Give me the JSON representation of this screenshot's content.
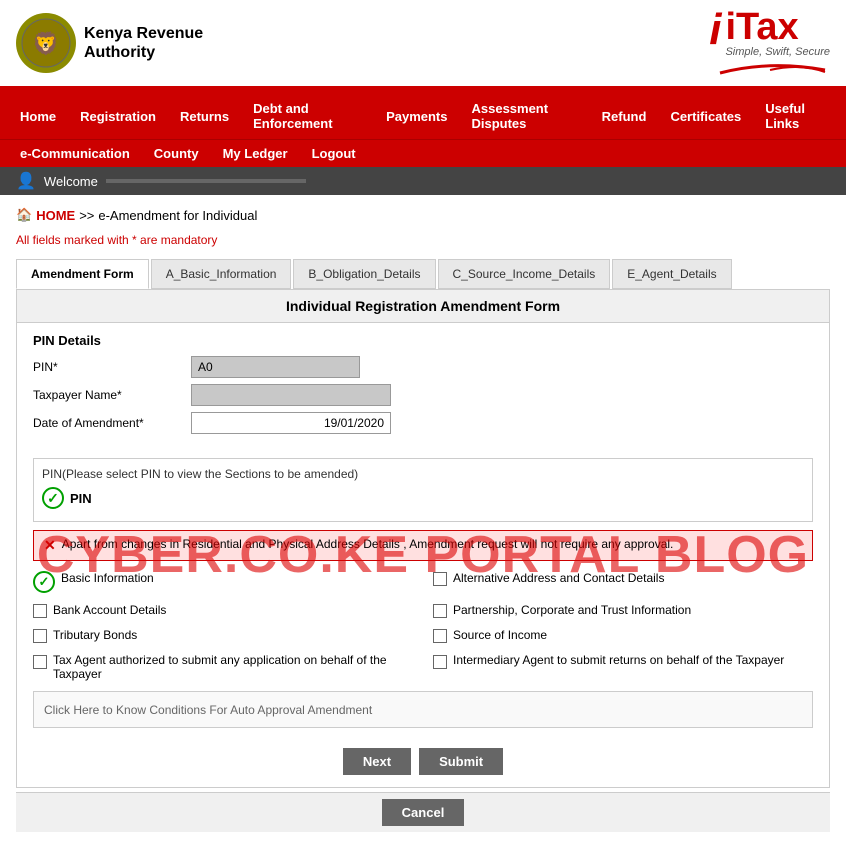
{
  "header": {
    "kra_name_line1": "Kenya Revenue",
    "kra_name_line2": "Authority",
    "itax_brand": "iTax",
    "itax_tagline": "Simple, Swift, Secure"
  },
  "nav_primary": {
    "items": [
      {
        "label": "Home",
        "id": "home"
      },
      {
        "label": "Registration",
        "id": "registration"
      },
      {
        "label": "Returns",
        "id": "returns"
      },
      {
        "label": "Debt and Enforcement",
        "id": "debt"
      },
      {
        "label": "Payments",
        "id": "payments"
      },
      {
        "label": "Assessment Disputes",
        "id": "assessment"
      },
      {
        "label": "Refund",
        "id": "refund"
      },
      {
        "label": "Certificates",
        "id": "certificates"
      },
      {
        "label": "Useful Links",
        "id": "useful"
      }
    ]
  },
  "nav_secondary": {
    "items": [
      {
        "label": "e-Communication",
        "id": "ecommunication"
      },
      {
        "label": "County",
        "id": "county"
      },
      {
        "label": "My Ledger",
        "id": "myledger"
      },
      {
        "label": "Logout",
        "id": "logout"
      }
    ]
  },
  "welcome": {
    "label": "Welcome"
  },
  "breadcrumb": {
    "home": "HOME",
    "separator": ">>",
    "current": "e-Amendment for Individual"
  },
  "mandatory_note": "All fields marked with * are mandatory",
  "tabs": [
    {
      "label": "Amendment Form",
      "active": true
    },
    {
      "label": "A_Basic_Information"
    },
    {
      "label": "B_Obligation_Details"
    },
    {
      "label": "C_Source_Income_Details"
    },
    {
      "label": "E_Agent_Details"
    }
  ],
  "form_title": "Individual Registration Amendment Form",
  "watermark": "CYBER.CO.KE PORTAL BLOG",
  "pin_details": {
    "section_title": "PIN Details",
    "pin_label": "PIN*",
    "pin_value": "A0",
    "taxpayer_label": "Taxpayer Name*",
    "taxpayer_value": "",
    "date_label": "Date of Amendment*",
    "date_value": "19/01/2020"
  },
  "pin_selection": {
    "label": "PIN(Please select PIN to view the Sections to be amended)",
    "pin_checkbox_label": "PIN",
    "pin_checked": true
  },
  "info_message": "Apart from changes in Residential and Physical Address Details , Amendment request will not require any approval.",
  "checkboxes": [
    {
      "label": "Basic Information",
      "checked": true,
      "circle": true
    },
    {
      "label": "Alternative Address and Contact Details",
      "checked": false
    },
    {
      "label": "Bank Account Details",
      "checked": false
    },
    {
      "label": "Partnership, Corporate and Trust Information",
      "checked": false
    },
    {
      "label": "Tributary Bonds",
      "checked": false
    },
    {
      "label": "Source of Income",
      "checked": false
    },
    {
      "label": "Tax Agent authorized to submit any application on behalf of the Taxpayer",
      "checked": false
    },
    {
      "label": "Intermediary Agent to submit returns on behalf of the Taxpayer",
      "checked": false
    }
  ],
  "auto_approval": {
    "text": "Click Here to Know Conditions For Auto Approval Amendment"
  },
  "buttons": {
    "next": "Next",
    "submit": "Submit",
    "cancel": "Cancel"
  }
}
